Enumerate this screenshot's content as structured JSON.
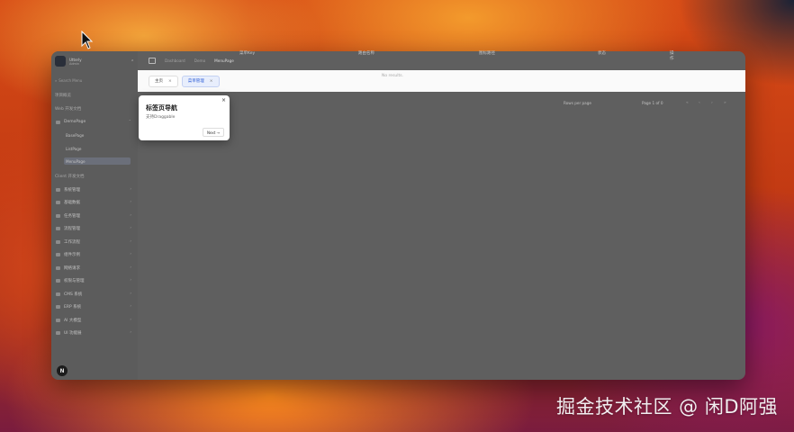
{
  "app": {
    "brand_title": "Utterly",
    "brand_subtitle": "Admin"
  },
  "sidebar": {
    "search_placeholder": "Search Menu",
    "group_1": "Web 开发文档",
    "group_0": "项目概览",
    "group_2": "Client 开发文档",
    "demo": {
      "label": "DemoPage",
      "children": [
        "BasePage",
        "ListPage",
        "MenuPage"
      ]
    },
    "items": [
      "系统管理",
      "基础数据",
      "任务管理",
      "流程管理",
      "工作流程",
      "组件示例",
      "网络请求",
      "权限与管理",
      "CMS 系统",
      "ERP 系统",
      "AI 大模型",
      "UI 功能展"
    ],
    "avatar_letter": "N"
  },
  "topbar": {
    "crumbs": [
      "Dashboard",
      "Demo",
      "MenuPage"
    ]
  },
  "tabs": [
    {
      "label": "主页",
      "active": false
    },
    {
      "label": "菜单管理",
      "active": true
    }
  ],
  "table": {
    "columns": [
      "菜单Key",
      "路由名称",
      "图标路径",
      "状态",
      "操作"
    ],
    "empty_text": "No results.",
    "rows_per_page": "Rows per page",
    "page_info": "Page 1 of 0",
    "pager_buttons": [
      "«",
      "‹",
      "›",
      "»"
    ]
  },
  "popover": {
    "title": "标签页导航",
    "description": "支持Draggable",
    "next_label": "Next →",
    "close_label": "×"
  },
  "watermark": "掘金技术社区 @ 闲D阿强"
}
